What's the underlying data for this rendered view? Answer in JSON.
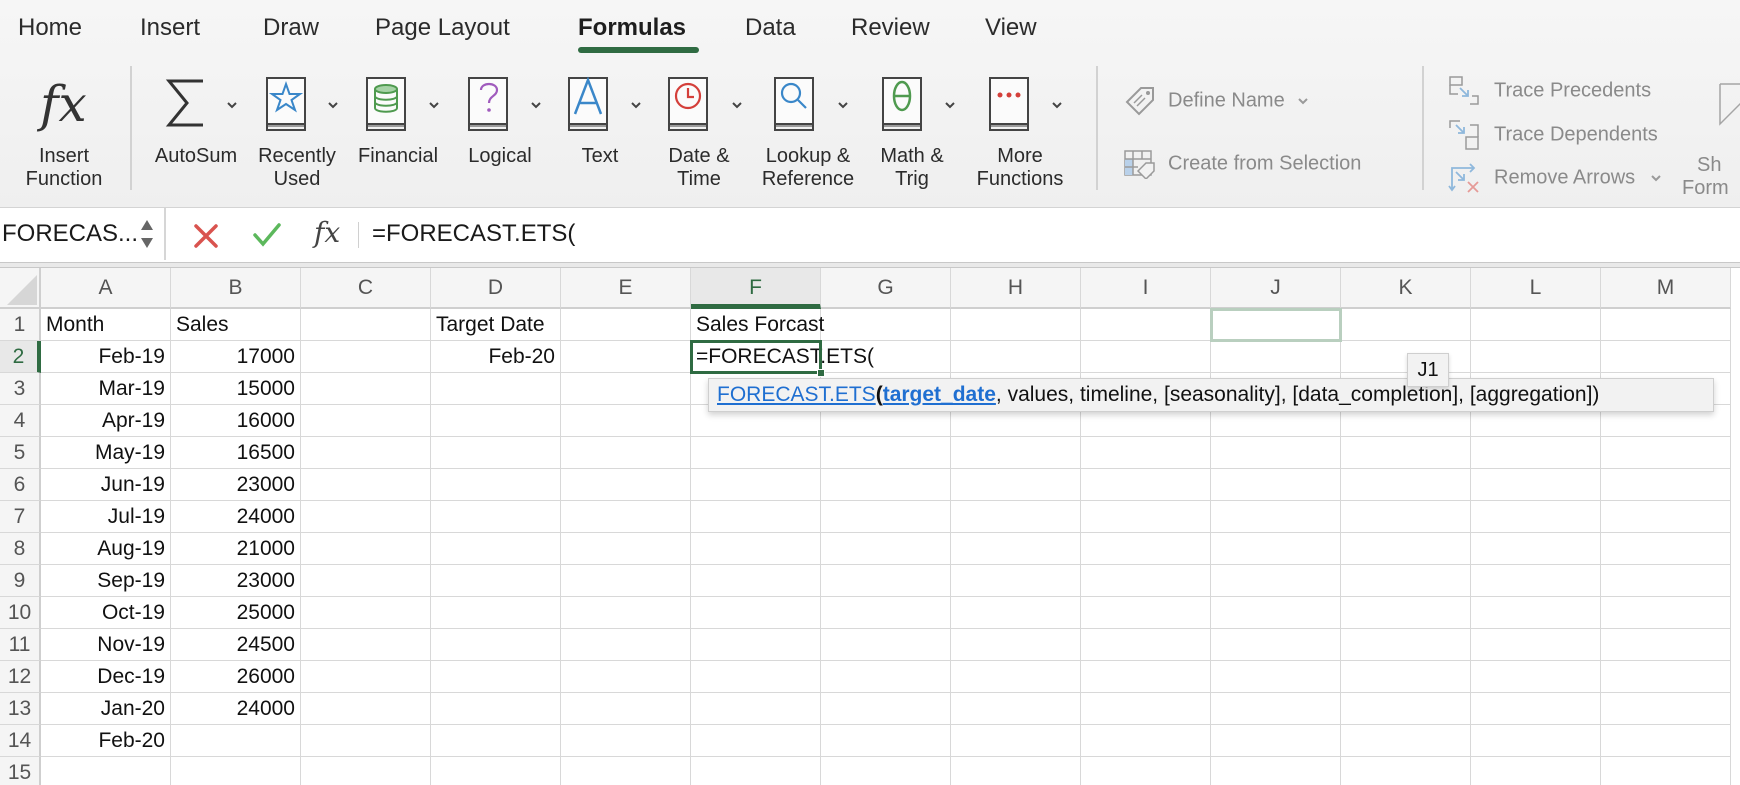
{
  "ribbon": {
    "tabs": [
      {
        "label": "Home",
        "active": false
      },
      {
        "label": "Insert",
        "active": false
      },
      {
        "label": "Draw",
        "active": false
      },
      {
        "label": "Page Layout",
        "active": false
      },
      {
        "label": "Formulas",
        "active": true
      },
      {
        "label": "Data",
        "active": false
      },
      {
        "label": "Review",
        "active": false
      },
      {
        "label": "View",
        "active": false
      }
    ],
    "accent_color": "#2f6b42",
    "insert_function": {
      "line1": "Insert",
      "line2": "Function",
      "icon": "fx-icon"
    },
    "library": [
      {
        "line1": "AutoSum",
        "line2": "",
        "icon": "sigma-icon"
      },
      {
        "line1": "Recently",
        "line2": "Used",
        "icon": "star-book-icon",
        "color": "#3a87c9"
      },
      {
        "line1": "Financial",
        "line2": "",
        "icon": "database-book-icon",
        "color": "#4f9a4f"
      },
      {
        "line1": "Logical",
        "line2": "",
        "icon": "question-book-icon",
        "color": "#a05bbd"
      },
      {
        "line1": "Text",
        "line2": "",
        "icon": "letter-a-book-icon",
        "color": "#3a87c9"
      },
      {
        "line1": "Date &",
        "line2": "Time",
        "icon": "clock-book-icon",
        "color": "#d43f3a"
      },
      {
        "line1": "Lookup &",
        "line2": "Reference",
        "icon": "magnifier-book-icon",
        "color": "#3a87c9"
      },
      {
        "line1": "Math &",
        "line2": "Trig",
        "icon": "theta-book-icon",
        "color": "#4f9a4f"
      },
      {
        "line1": "More",
        "line2": "Functions",
        "icon": "dots-book-icon",
        "color": "#d43f3a"
      }
    ],
    "defined_names": {
      "define_name": "Define Name",
      "create_from_selection": "Create from Selection"
    },
    "auditing": {
      "trace_precedents": "Trace Precedents",
      "trace_dependents": "Trace Dependents",
      "remove_arrows": "Remove Arrows",
      "show_formulas_line1": "Sh",
      "show_formulas_line2": "Form"
    }
  },
  "formula_bar": {
    "name_box": "FORECAS...",
    "formula": "=FORECAST.ETS(",
    "cancel_color": "#d9534f",
    "enter_color": "#5cb85c"
  },
  "grid": {
    "columns": [
      "A",
      "B",
      "C",
      "D",
      "E",
      "F",
      "G",
      "H",
      "I",
      "J",
      "K",
      "L",
      "M"
    ],
    "selected_column": "F",
    "selected_row": 2,
    "rows": [
      1,
      2,
      3,
      4,
      5,
      6,
      7,
      8,
      9,
      10,
      11,
      12,
      13,
      14,
      15
    ],
    "cells": {
      "A1": "Month",
      "B1": "Sales",
      "D1": "Target Date",
      "F1": "Sales Forcast",
      "A2": "Feb-19",
      "B2": "17000",
      "D2": "Feb-20",
      "F2": "=FORECAST.ETS(",
      "A3": "Mar-19",
      "B3": "15000",
      "A4": "Apr-19",
      "B4": "16000",
      "A5": "May-19",
      "B5": "16500",
      "A6": "Jun-19",
      "B6": "23000",
      "A7": "Jul-19",
      "B7": "24000",
      "A8": "Aug-19",
      "B8": "21000",
      "A9": "Sep-19",
      "B9": "23000",
      "A10": "Oct-19",
      "B10": "25000",
      "A11": "Nov-19",
      "B11": "24500",
      "A12": "Dec-19",
      "B12": "26000",
      "A13": "Jan-20",
      "B13": "24000",
      "A14": "Feb-20"
    }
  },
  "tooltip": {
    "function_name": "FORECAST.ETS",
    "open_paren": "(",
    "active_arg": "target_date",
    "rest": ", values, timeline, [seasonality], [data_completion], [aggregation])"
  },
  "reference_tag": "J1"
}
